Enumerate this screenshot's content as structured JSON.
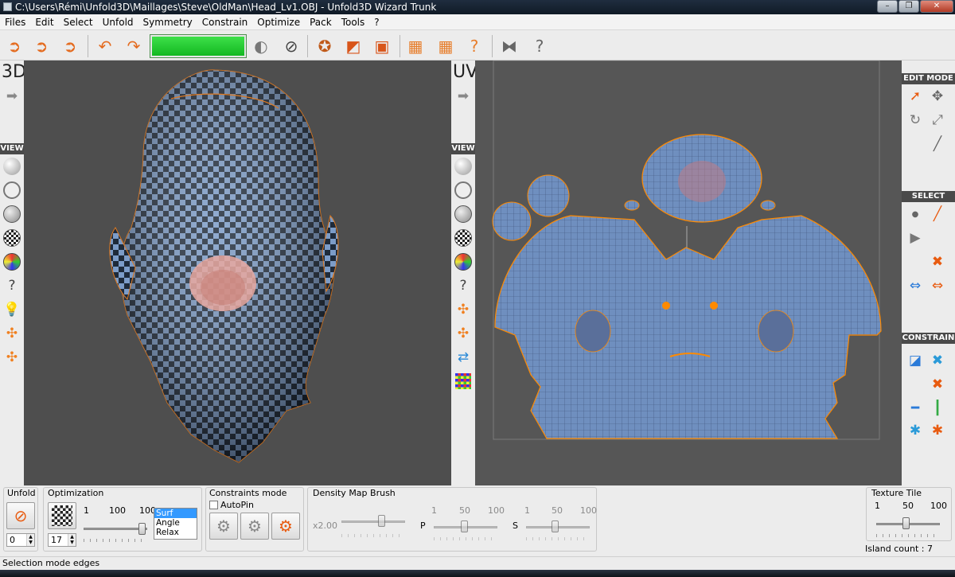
{
  "window": {
    "title": "C:\\Users\\Rémi\\Unfold3D\\Maillages\\Steve\\OldMan\\Head_Lv1.OBJ - Unfold3D Wizard  Trunk"
  },
  "menu": [
    "Files",
    "Edit",
    "Select",
    "Unfold",
    "Symmetry",
    "Constrain",
    "Optimize",
    "Pack",
    "Tools",
    "?"
  ],
  "toolbar": {
    "progress": 1.0
  },
  "panels": {
    "left_label": "3D",
    "right_label": "UV",
    "view_label": "VIEW"
  },
  "right_sidebar": {
    "edit_mode": "EDIT MODE",
    "select": "SELECT",
    "constrain": "CONSTRAIN"
  },
  "bottom": {
    "unfold": {
      "label": "Unfold",
      "value": "0"
    },
    "optimization": {
      "label": "Optimization",
      "scale": [
        "1",
        "100",
        "100"
      ],
      "value": "17",
      "options": [
        "Surf",
        "Angle",
        "Relax"
      ],
      "selected": "Surf"
    },
    "constraints": {
      "label": "Constraints mode",
      "autopin": "AutoPin"
    },
    "density": {
      "label": "Density Map Brush",
      "zoom": "x2.00",
      "scale1": [
        "1",
        "50",
        "100"
      ],
      "scale2": [
        "1",
        "50",
        "100"
      ],
      "p": "P",
      "s": "S"
    },
    "texture": {
      "label": "Texture Tile",
      "scale": [
        "1",
        "50",
        "100"
      ],
      "island": "Island count : 7"
    }
  },
  "status": "Selection mode edges",
  "colors": {
    "mesh_blue": "#6f8fbf",
    "seam_orange": "#ff8a00",
    "progress_green": "#1fcf2c"
  }
}
